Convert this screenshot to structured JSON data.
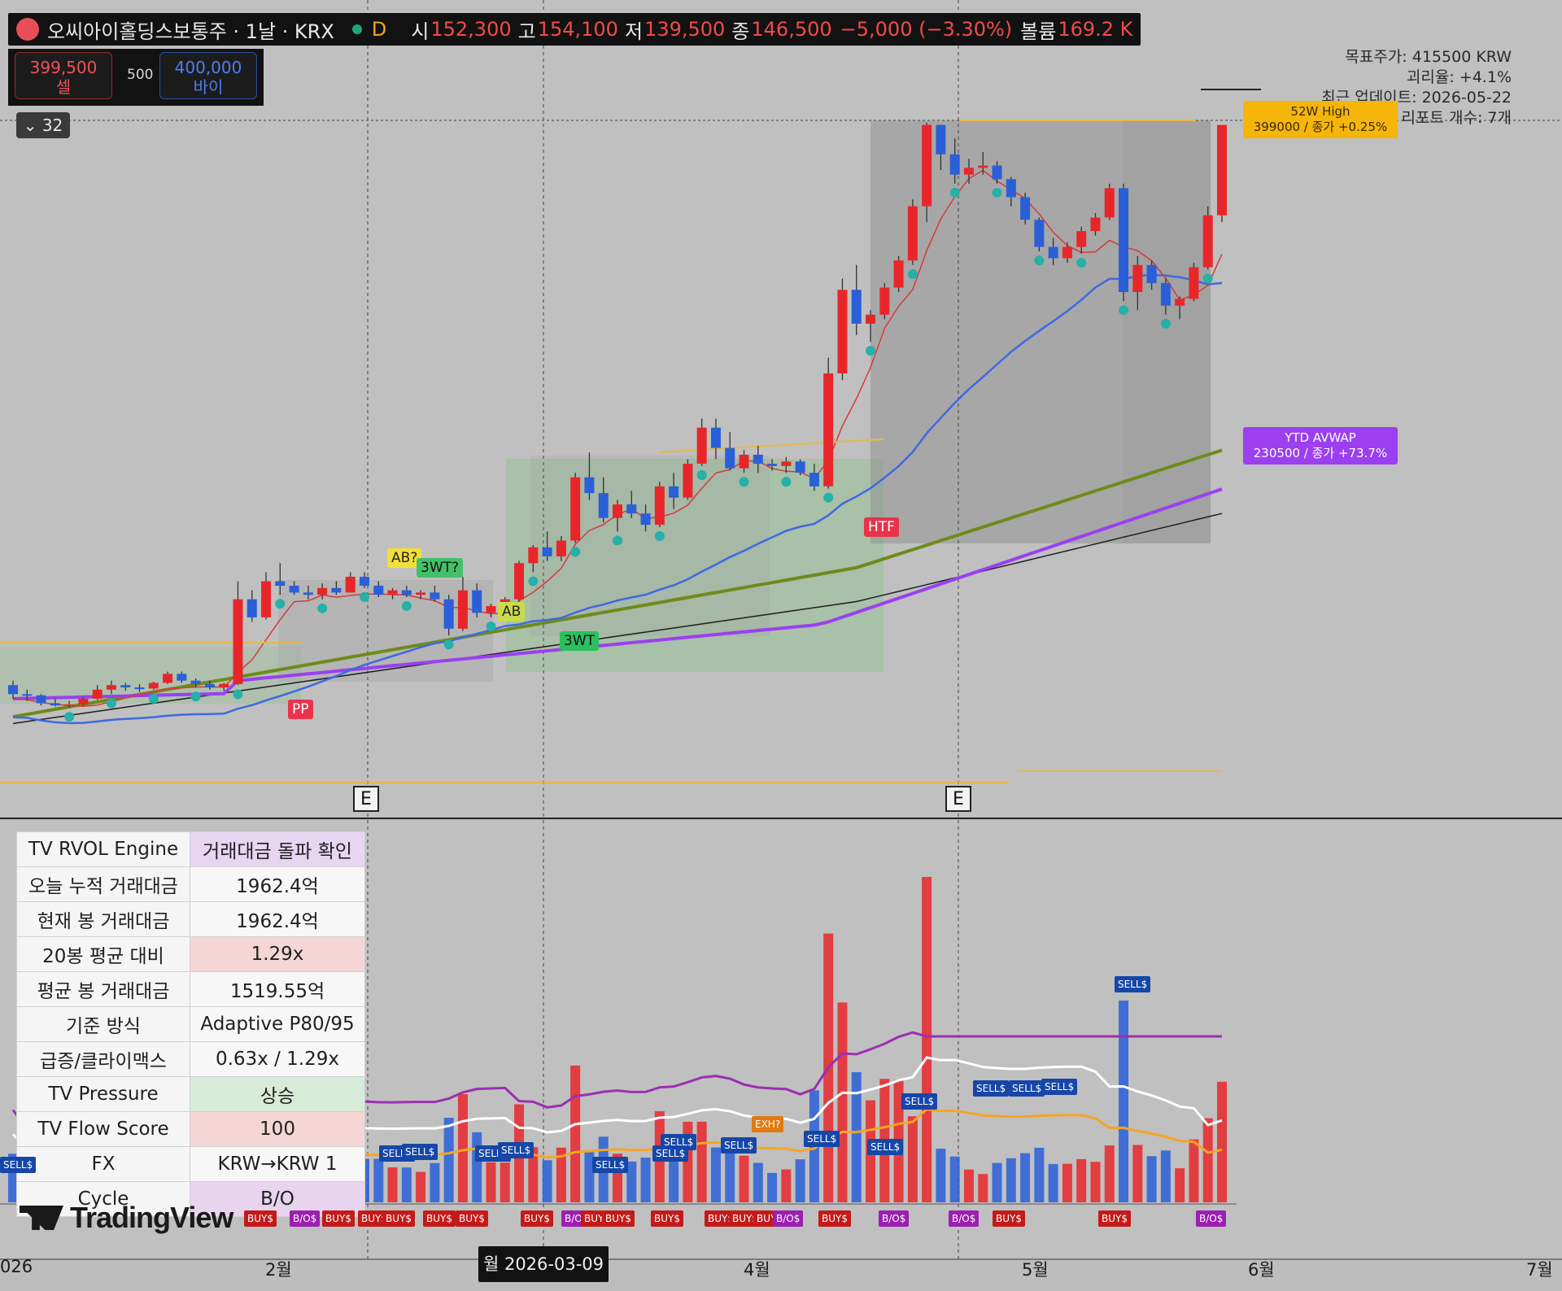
{
  "header": {
    "title": "오씨아이홀딩스보통주 · 1날 · KRX",
    "interval_badge": "D",
    "open_label": "시",
    "open": "152,300",
    "high_label": "고",
    "high": "154,100",
    "low_label": "저",
    "low": "139,500",
    "close_label": "종",
    "close": "146,500",
    "change": "−5,000 (−3.30%)",
    "volume_label": "볼륨",
    "volume": "169.2 K"
  },
  "trade": {
    "sell_price": "399,500",
    "sell_label": "셀",
    "spread": "500",
    "buy_price": "400,000",
    "buy_label": "바이"
  },
  "collapse_count": "32",
  "info_panel": {
    "line1": "목표주가: 415500 KRW",
    "line2": "괴리율: +4.1%",
    "line3": "최근 업데이트: 2026-05-22",
    "line4": "리포트 개수: 7개"
  },
  "price_tags": {
    "last_title": "52W High",
    "last_value": "399000 / 종가 +0.25%",
    "avwap_title": "YTD AVWAP",
    "avwap_value": "230500 / 종가 +73.7%"
  },
  "pattern_labels": {
    "ab1": "AB?",
    "wt1": "3WT?",
    "ab2": "AB",
    "wt2": "3WT",
    "pp": "PP",
    "htf": "HTF"
  },
  "earnings_marker": "E",
  "rvol_table": [
    [
      "TV RVOL Engine",
      "거래대금 돌파 확인"
    ],
    [
      "오늘 누적 거래대금",
      "1962.4억"
    ],
    [
      "현재 봉 거래대금",
      "1962.4억"
    ],
    [
      "20봉 평균 대비",
      "1.29x"
    ],
    [
      "평균 봉 거래대금",
      "1519.55억"
    ],
    [
      "기준 방식",
      "Adaptive P80/95"
    ],
    [
      "급증/클라이맥스",
      "0.63x / 1.29x"
    ],
    [
      "TV Pressure",
      "상승"
    ],
    [
      "TV Flow Score",
      "100"
    ],
    [
      "FX",
      "KRW→KRW 1"
    ],
    [
      "Cycle",
      "B/O"
    ]
  ],
  "rvol_colors": {
    "0": "#e7d6f2",
    "3": "#f6d5d7",
    "7": "#d7ebd9",
    "8": "#f6d5d7",
    "10": "#e8d4ef"
  },
  "signals": {
    "sell": "SELL$",
    "exh": "EXH?",
    "buy": "BUY$",
    "bo": "B/O$"
  },
  "brand": "TradingView",
  "time_axis": {
    "labels": [
      "026",
      "2월",
      "4월",
      "5월",
      "6월",
      "7월"
    ],
    "crosshair_date": "월 2026-03-09"
  },
  "colors": {
    "up": "#e8262a",
    "down": "#2a5fd8",
    "ma_blue": "#3d6ae0",
    "ma_purple": "#9b3ff0",
    "ma_olive": "#6f8a1a",
    "ma_black": "#1e1e1e",
    "gold": "#e6b84a",
    "teal": "#26b0a8"
  },
  "chart_data": {
    "type": "candlestick",
    "note_axes": "price (KRW) – no printed y-axis",
    "candles": [
      [
        150000,
        152000,
        144000,
        146000
      ],
      [
        146000,
        148000,
        143000,
        145500
      ],
      [
        145500,
        146000,
        141000,
        142000
      ],
      [
        142000,
        144000,
        140500,
        141000
      ],
      [
        141000,
        143000,
        140000,
        141500
      ],
      [
        141500,
        144500,
        141000,
        144000
      ],
      [
        144000,
        150000,
        143500,
        148000
      ],
      [
        148000,
        152000,
        146000,
        150000
      ],
      [
        150000,
        151000,
        147500,
        149000
      ],
      [
        149000,
        150500,
        147000,
        148500
      ],
      [
        148500,
        151500,
        148000,
        151000
      ],
      [
        151000,
        156000,
        150500,
        155000
      ],
      [
        155000,
        156000,
        151000,
        152000
      ],
      [
        152000,
        153000,
        149000,
        150500
      ],
      [
        150500,
        152000,
        148000,
        149000
      ],
      [
        149000,
        151000,
        147500,
        150500
      ],
      [
        150500,
        196000,
        150000,
        188000
      ],
      [
        188000,
        192000,
        178000,
        180000
      ],
      [
        180000,
        200000,
        179000,
        196000
      ],
      [
        196000,
        204000,
        190000,
        194000
      ],
      [
        194000,
        196000,
        190000,
        191000
      ],
      [
        191000,
        194000,
        188000,
        190000
      ],
      [
        190000,
        195000,
        188000,
        193000
      ],
      [
        193000,
        196000,
        190000,
        191000
      ],
      [
        191000,
        200000,
        191000,
        198000
      ],
      [
        198000,
        200000,
        193000,
        194000
      ],
      [
        194000,
        196000,
        189000,
        190000
      ],
      [
        190000,
        193000,
        188000,
        192000
      ],
      [
        192000,
        194000,
        189000,
        190000
      ],
      [
        190000,
        192000,
        188000,
        191000
      ],
      [
        191000,
        194000,
        187000,
        188000
      ],
      [
        188000,
        190000,
        172000,
        175000
      ],
      [
        175000,
        198000,
        174000,
        192000
      ],
      [
        192000,
        195000,
        180000,
        182000
      ],
      [
        182000,
        186000,
        180000,
        185000
      ],
      [
        185000,
        189000,
        183000,
        188000
      ],
      [
        188000,
        205000,
        187000,
        204000
      ],
      [
        204000,
        212000,
        200000,
        211000
      ],
      [
        211000,
        218000,
        205000,
        207000
      ],
      [
        207000,
        216000,
        205000,
        214000
      ],
      [
        214000,
        244000,
        213000,
        242000
      ],
      [
        242000,
        253000,
        232000,
        235000
      ],
      [
        235000,
        242000,
        222000,
        224000
      ],
      [
        224000,
        232000,
        218000,
        230000
      ],
      [
        230000,
        236000,
        224000,
        226000
      ],
      [
        226000,
        230000,
        218000,
        221000
      ],
      [
        221000,
        240000,
        220000,
        238000
      ],
      [
        238000,
        244000,
        228000,
        233000
      ],
      [
        233000,
        250000,
        232000,
        248000
      ],
      [
        248000,
        268000,
        247000,
        264000
      ],
      [
        264000,
        268000,
        250000,
        255000
      ],
      [
        255000,
        262000,
        245000,
        246000
      ],
      [
        246000,
        254000,
        244000,
        252000
      ],
      [
        252000,
        256000,
        244000,
        248000
      ],
      [
        248000,
        250000,
        245000,
        247000
      ],
      [
        247000,
        251000,
        244000,
        249000
      ],
      [
        249000,
        250000,
        243000,
        244000
      ],
      [
        244000,
        248000,
        236000,
        238000
      ],
      [
        238000,
        295000,
        237000,
        288000
      ],
      [
        288000,
        330000,
        285000,
        325000
      ],
      [
        325000,
        336000,
        305000,
        310000
      ],
      [
        310000,
        316000,
        302000,
        314000
      ],
      [
        314000,
        328000,
        312000,
        326000
      ],
      [
        326000,
        340000,
        324000,
        338000
      ],
      [
        338000,
        365000,
        336000,
        362000
      ],
      [
        362000,
        399000,
        355000,
        398000
      ],
      [
        398000,
        398000,
        378000,
        385000
      ],
      [
        385000,
        392000,
        372000,
        376000
      ],
      [
        376000,
        383000,
        372000,
        379000
      ],
      [
        379000,
        386000,
        376000,
        380000
      ],
      [
        380000,
        382000,
        372000,
        374000
      ],
      [
        374000,
        375000,
        362000,
        366000
      ],
      [
        366000,
        368000,
        354000,
        356000
      ],
      [
        356000,
        357000,
        342000,
        344000
      ],
      [
        344000,
        348000,
        336000,
        339000
      ],
      [
        339000,
        346000,
        337000,
        344000
      ],
      [
        344000,
        353000,
        341000,
        351000
      ],
      [
        351000,
        359000,
        349000,
        357000
      ],
      [
        357000,
        372000,
        356000,
        370000
      ],
      [
        370000,
        372000,
        320000,
        324000
      ],
      [
        324000,
        340000,
        316000,
        336000
      ],
      [
        336000,
        338000,
        325000,
        328000
      ],
      [
        328000,
        330000,
        314000,
        318000
      ],
      [
        318000,
        322000,
        312000,
        321000
      ],
      [
        321000,
        337000,
        320000,
        335000
      ],
      [
        335000,
        362000,
        334000,
        358000
      ],
      [
        358000,
        397000,
        355000,
        398000
      ]
    ],
    "volume_bars": "approximate, 0–100 relative"
  }
}
